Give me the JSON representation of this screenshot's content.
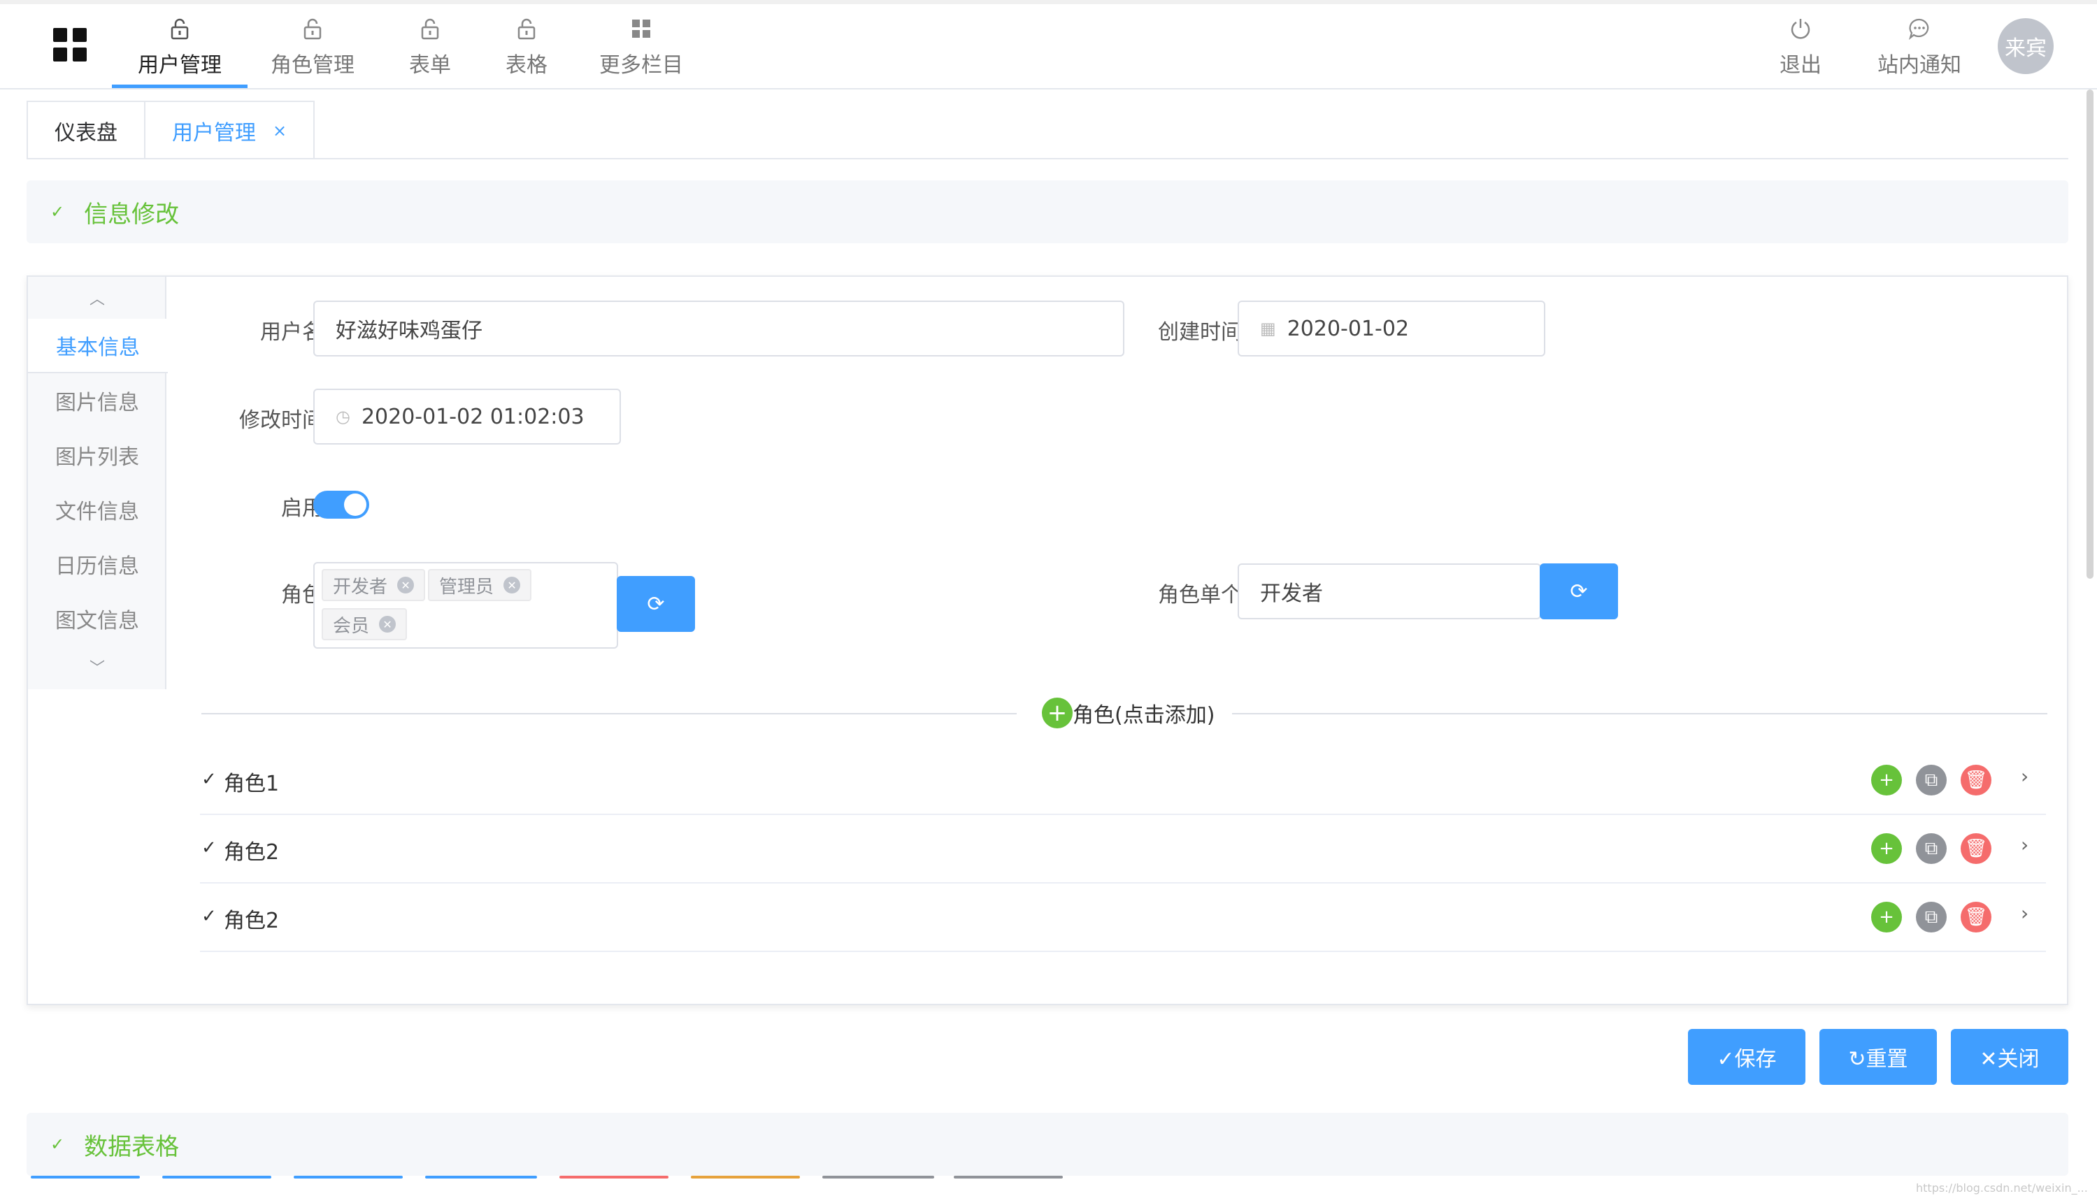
{
  "header": {
    "nav": [
      {
        "label": "用户管理",
        "icon": "lock-icon",
        "active": true
      },
      {
        "label": "角色管理",
        "icon": "lock-icon",
        "active": false
      },
      {
        "label": "表单",
        "icon": "lock-icon",
        "active": false
      },
      {
        "label": "表格",
        "icon": "lock-icon",
        "active": false
      },
      {
        "label": "更多栏目",
        "icon": "grid-icon",
        "active": false
      }
    ],
    "right": [
      {
        "label": "退出",
        "icon": "power-icon"
      },
      {
        "label": "站内通知",
        "icon": "message-icon"
      }
    ],
    "avatar": "来宾"
  },
  "tabs": [
    {
      "label": "仪表盘",
      "active": false
    },
    {
      "label": "用户管理",
      "active": true,
      "close": "×"
    }
  ],
  "section_info": {
    "title": "信息修改"
  },
  "side_menu": {
    "items": [
      "基本信息",
      "图片信息",
      "图片列表",
      "文件信息",
      "日历信息",
      "图文信息"
    ],
    "active_index": 0
  },
  "form": {
    "username": {
      "label": "用户名",
      "value": "好滋好味鸡蛋仔"
    },
    "created": {
      "label": "创建时间",
      "value": "2020-01-02"
    },
    "modified": {
      "label": "修改时间",
      "value": "2020-01-02 01:02:03"
    },
    "enabled": {
      "label": "启用",
      "on": true
    },
    "roles": {
      "label": "角色",
      "tags": [
        "开发者",
        "管理员",
        "会员"
      ]
    },
    "single_role": {
      "label": "角色单个",
      "value": "开发者"
    }
  },
  "roles_section": {
    "divider_label": "角色(点击添加)",
    "rows": [
      "角色1",
      "角色2",
      "角色2"
    ]
  },
  "actions": {
    "save": "✓保存",
    "reset": "↻重置",
    "close": "✕关闭"
  },
  "section_table": {
    "title": "数据表格"
  },
  "watermark": "https://blog.csdn.net/weixin_..."
}
